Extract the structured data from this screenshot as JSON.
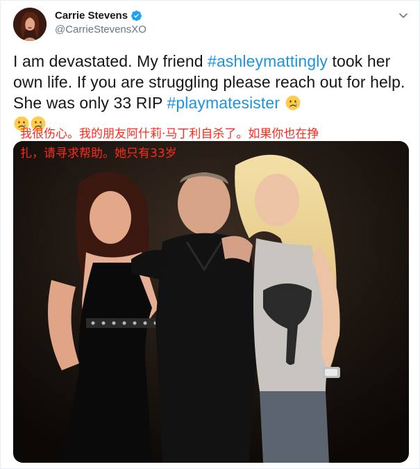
{
  "author": {
    "display_name": "Carrie Stevens",
    "handle": "@CarrieStevensXO",
    "verified": true,
    "avatar_icon": "profile-photo"
  },
  "tweet": {
    "text_parts": [
      "I am devastated.  My friend ",
      "#ashleymattingly",
      " took her own life. If you are struggling please reach out for help.  She was only 33 RIP ",
      "#playmatesister"
    ],
    "emojis": [
      "crying-face-emoji",
      "crying-face-emoji",
      "crying-face-emoji"
    ]
  },
  "overlay_caption": {
    "line1": "我很伤心。我的朋友阿什莉·马丁利自杀了。如果你也在挣",
    "line2": "扎，请寻求帮助。她只有33岁",
    "color": "#ff2a1a"
  },
  "colors": {
    "hashtag": "#1b95e0",
    "verified_badge": "#1da1f2",
    "text": "#14171a",
    "secondary": "#657786"
  },
  "icons": {
    "menu": "chevron-down-icon",
    "verified": "verified-badge-icon"
  }
}
